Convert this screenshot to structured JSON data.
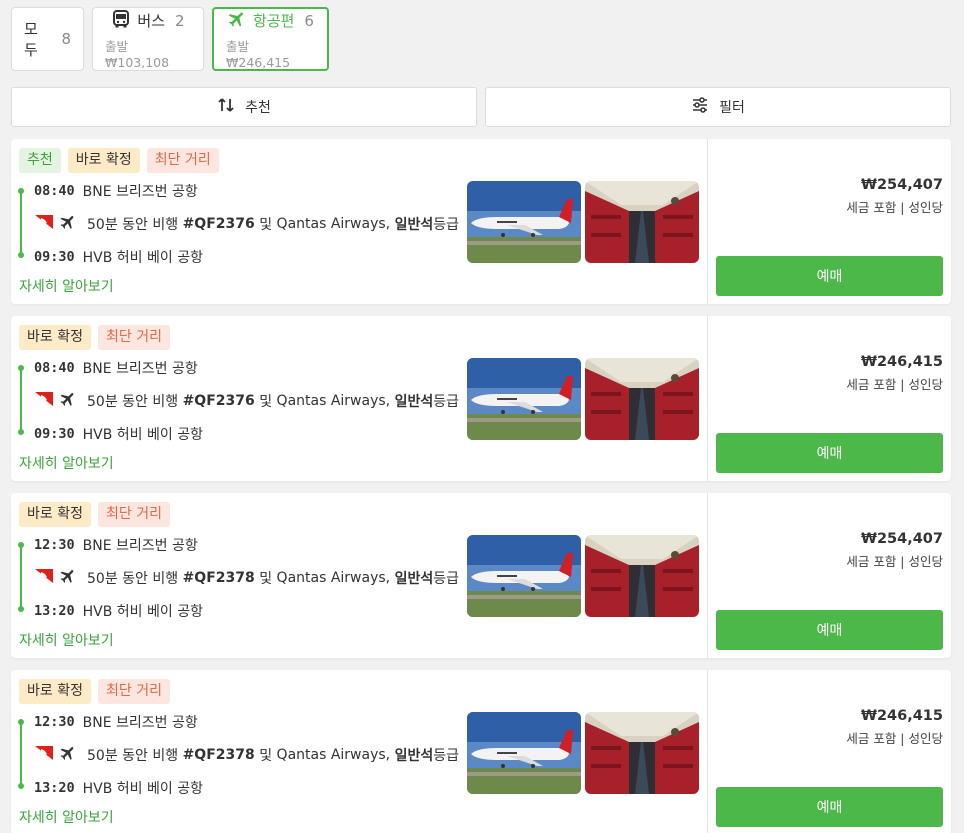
{
  "tabs": {
    "all": {
      "label": "모두",
      "count": "8"
    },
    "bus": {
      "label": "버스",
      "count": "2",
      "sub": "출발 ₩103,108"
    },
    "flight": {
      "label": "항공편",
      "count": "6",
      "sub": "출발 ₩246,415"
    }
  },
  "controls": {
    "sort_label": "추천",
    "filter_label": "필터"
  },
  "colors": {
    "accent": "#4cb849"
  },
  "results": [
    {
      "badges": [
        "추천",
        "바로 확정",
        "최단 거리"
      ],
      "depart_time": "08:40",
      "depart_place": "BNE 브리즈번 공항",
      "duration": "50분 동안 비행",
      "flight_no": "#QF2376",
      "conj": "및",
      "airline": "Qantas Airways,",
      "class": "일반석",
      "class_suffix": "등급",
      "arrive_time": "09:30",
      "arrive_place": "HVB 허비 베이 공항",
      "more": "자세히 알아보기",
      "price": "₩254,407",
      "price_note": "세금 포함 | 성인당",
      "book": "예매"
    },
    {
      "badges": [
        "바로 확정",
        "최단 거리"
      ],
      "depart_time": "08:40",
      "depart_place": "BNE 브리즈번 공항",
      "duration": "50분 동안 비행",
      "flight_no": "#QF2376",
      "conj": "및",
      "airline": "Qantas Airways,",
      "class": "일반석",
      "class_suffix": "등급",
      "arrive_time": "09:30",
      "arrive_place": "HVB 허비 베이 공항",
      "more": "자세히 알아보기",
      "price": "₩246,415",
      "price_note": "세금 포함 | 성인당",
      "book": "예매"
    },
    {
      "badges": [
        "바로 확정",
        "최단 거리"
      ],
      "depart_time": "12:30",
      "depart_place": "BNE 브리즈번 공항",
      "duration": "50분 동안 비행",
      "flight_no": "#QF2378",
      "conj": "및",
      "airline": "Qantas Airways,",
      "class": "일반석",
      "class_suffix": "등급",
      "arrive_time": "13:20",
      "arrive_place": "HVB 허비 베이 공항",
      "more": "자세히 알아보기",
      "price": "₩254,407",
      "price_note": "세금 포함 | 성인당",
      "book": "예매"
    },
    {
      "badges": [
        "바로 확정",
        "최단 거리"
      ],
      "depart_time": "12:30",
      "depart_place": "BNE 브리즈번 공항",
      "duration": "50분 동안 비행",
      "flight_no": "#QF2378",
      "conj": "및",
      "airline": "Qantas Airways,",
      "class": "일반석",
      "class_suffix": "등급",
      "arrive_time": "13:20",
      "arrive_place": "HVB 허비 베이 공항",
      "more": "자세히 알아보기",
      "price": "₩246,415",
      "price_note": "세금 포함 | 성인당",
      "book": "예매"
    }
  ]
}
